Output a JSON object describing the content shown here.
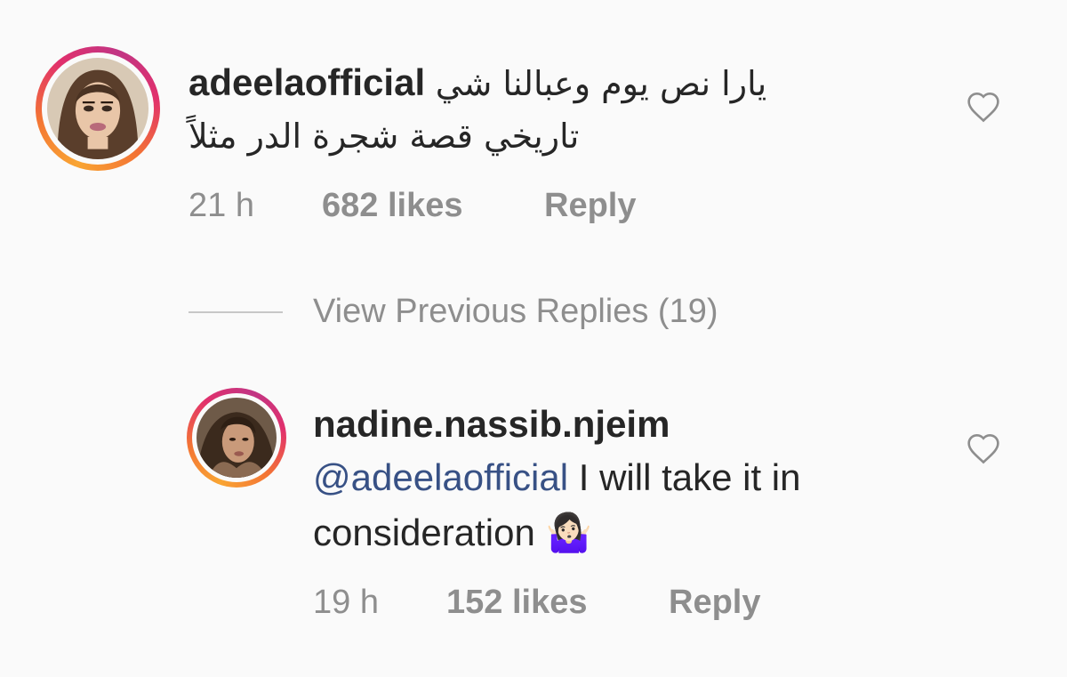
{
  "comments": [
    {
      "username": "adeelaofficial",
      "text_line1": "يارا نص يوم وعبالنا شي",
      "text_line2": "تاريخي قصة شجرة الدر مثلاً",
      "time": "21 h",
      "likes": "682 likes",
      "reply_label": "Reply",
      "liked": false
    }
  ],
  "view_previous": "View Previous Replies (19)",
  "replies": [
    {
      "username": "nadine.nassib.njeim",
      "mention": "@adeelaofficial",
      "text_line1": " I will take it in",
      "text_line2": "consideration 🤷🏻‍♀",
      "time": "19 h",
      "likes": "152 likes",
      "reply_label": "Reply",
      "liked": false
    }
  ],
  "colors": {
    "background": "#fafafa",
    "text": "#262626",
    "secondary": "#8e8e8e",
    "mention": "#385185",
    "ring_gradient": [
      "#f9a533",
      "#e1306c",
      "#c13584"
    ]
  },
  "icons": {
    "like": "heart-outline-icon"
  }
}
